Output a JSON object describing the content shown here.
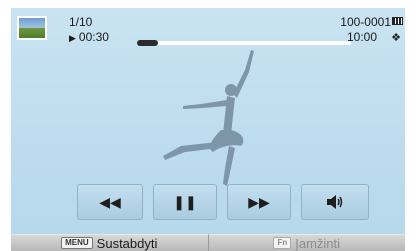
{
  "status": {
    "counter": "1/10",
    "elapsed": "00:30",
    "file_number": "100-0001",
    "total_time": "10:00",
    "progress_fraction": 0.1
  },
  "icons": {
    "thumbnail": "image-thumbnail-icon",
    "play": "play-icon",
    "battery": "battery-icon",
    "stabilizer": "shake-reduction-icon"
  },
  "controls": {
    "rewind": "rewind-icon",
    "pause": "pause-icon",
    "fast_forward": "fast-forward-icon",
    "volume": "volume-icon"
  },
  "bottom": {
    "stop_key": "MENU",
    "stop_label": "Sustabdyti",
    "record_key": "Fn",
    "record_label": "Įamžinti"
  },
  "colors": {
    "background": "#bcdced",
    "progress": "#2b2b2b",
    "silhouette": "#7e96a8"
  }
}
